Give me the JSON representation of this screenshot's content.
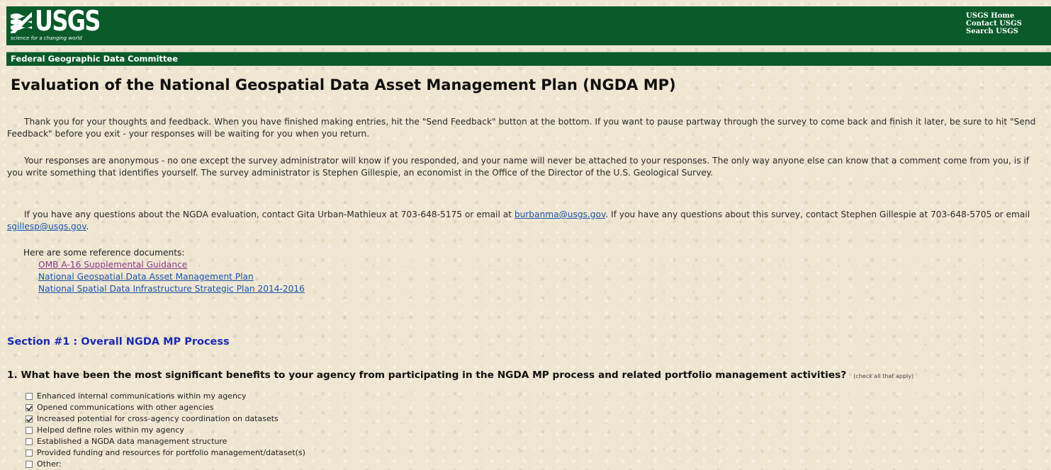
{
  "header": {
    "logo_text": "USGS",
    "logo_tagline": "science for a changing world",
    "links": [
      "USGS Home",
      "Contact USGS",
      "Search USGS"
    ],
    "subbar": "Federal Geographic Data Committee"
  },
  "page_title": "Evaluation of the National Geospatial Data Asset Management Plan (NGDA MP)",
  "intro": {
    "p1": "Thank you for your thoughts and feedback. When you have finished making entries, hit the \"Send Feedback\" button at the bottom. If you want to pause partway through the survey to come back and finish it later, be sure to hit \"Send Feedback\" before you exit - your responses will be waiting for you when you return.",
    "p2": "Your responses are anonymous - no one except the survey administrator will know if you responded, and your name will never be attached to your responses. The only way anyone else can know that a comment come from you, is if you write something that identifies yourself. The survey administrator is Stephen Gillespie, an economist in the Office of the Director of the U.S. Geological Survey.",
    "p3_a": "If you have any questions about the NGDA evaluation, contact Gita Urban-Mathieux at 703-648-5175 or email at ",
    "p3_link1": "burbanma@usgs.gov",
    "p3_b": ". If you have any questions about this survey, contact Stephen Gillespie at 703-648-5705 or email ",
    "p3_link2": "sgillesp@usgs.gov",
    "p3_c": "."
  },
  "references": {
    "heading": "Here are some reference documents:",
    "links": [
      "OMB A-16 Supplemental Guidance",
      "National Geospatial Data Asset Management Plan",
      "National Spatial Data Infrastructure Strategic Plan 2014-2016"
    ]
  },
  "section": {
    "title": "Section #1 : Overall NGDA MP Process"
  },
  "question1": {
    "text": "1. What have been the most significant benefits to your agency from participating in the NGDA MP process and related portfolio management activities?",
    "hint": "(check all that apply)",
    "options": [
      {
        "label": "Enhanced internal communications within my agency",
        "checked": false
      },
      {
        "label": "Opened communications with other agencies",
        "checked": true
      },
      {
        "label": "Increased potential for cross-agency coordination on datasets",
        "checked": true
      },
      {
        "label": "Helped define roles within my agency",
        "checked": false
      },
      {
        "label": "Established a NGDA data management structure",
        "checked": false
      },
      {
        "label": "Provided funding and resources for portfolio management/dataset(s)",
        "checked": false
      },
      {
        "label": "Other:",
        "checked": false
      }
    ]
  }
}
